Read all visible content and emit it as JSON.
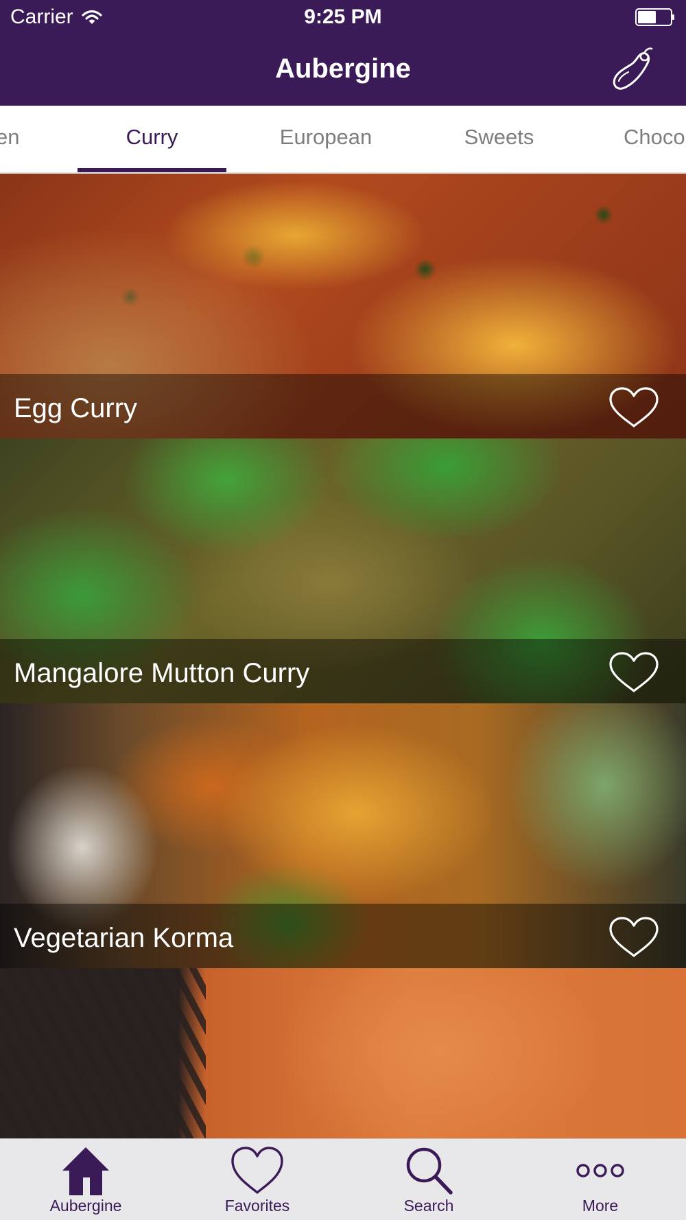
{
  "status_bar": {
    "carrier": "Carrier",
    "time": "9:25 PM"
  },
  "nav": {
    "title": "Aubergine"
  },
  "category_tabs": {
    "items": [
      "en",
      "Curry",
      "European",
      "Sweets",
      "Choco"
    ],
    "active": "Curry"
  },
  "recipes": [
    {
      "title": "Egg Curry",
      "favorite_icon": "heart-outline-icon"
    },
    {
      "title": "Mangalore Mutton Curry",
      "favorite_icon": "heart-outline-icon"
    },
    {
      "title": "Vegetarian Korma",
      "favorite_icon": "heart-outline-icon"
    },
    {
      "title": "",
      "favorite_icon": "heart-outline-icon"
    }
  ],
  "tab_bar": {
    "items": [
      {
        "label": "Aubergine",
        "icon": "house-icon",
        "selected": true
      },
      {
        "label": "Favorites",
        "icon": "heart-icon",
        "selected": false
      },
      {
        "label": "Search",
        "icon": "magnifier-icon",
        "selected": false
      },
      {
        "label": "More",
        "icon": "more-icon",
        "selected": false
      }
    ]
  },
  "colors": {
    "brand": "#3a1b57",
    "inactive_tab_text": "#7d7d7d",
    "tab_bar_bg": "#e8e7ea"
  }
}
